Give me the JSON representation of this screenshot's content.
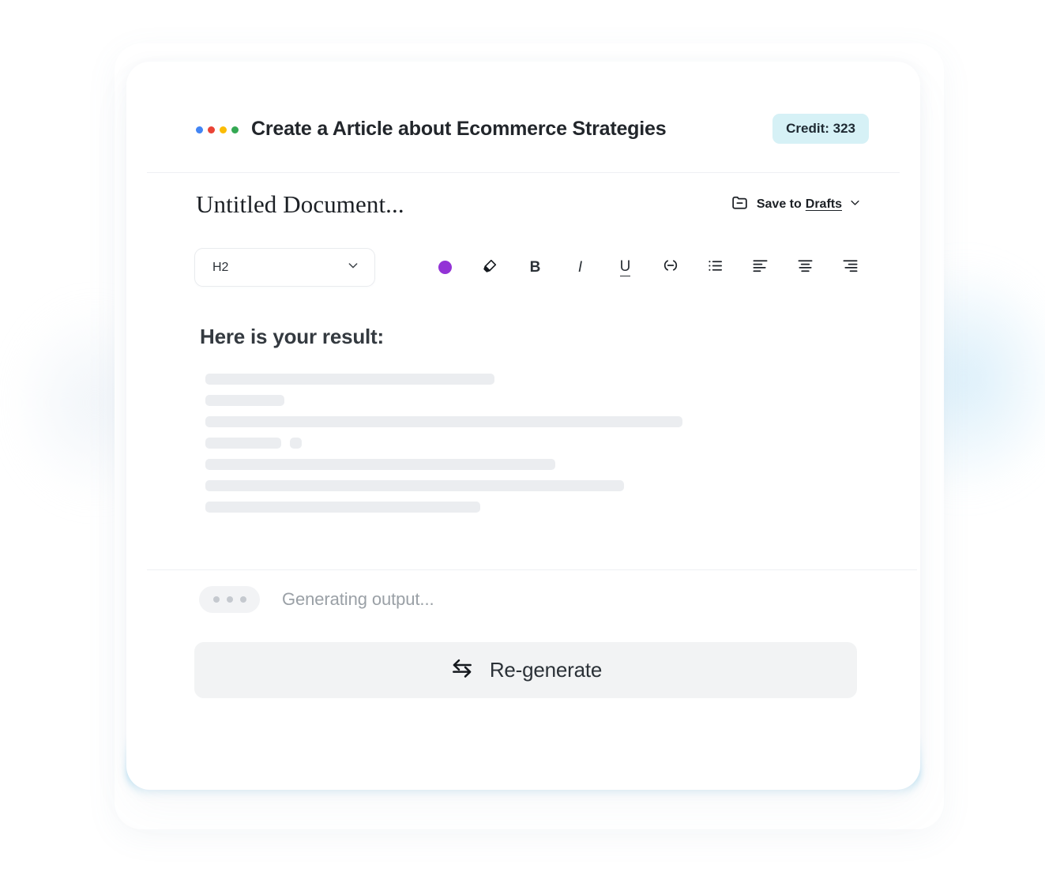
{
  "header": {
    "logo_icon": "four-dots-logo",
    "logo_dots": [
      "#4285f4",
      "#ea4335",
      "#fbbc05",
      "#34a853"
    ],
    "title": "Create a Article about Ecommerce Strategies",
    "credit_badge": "Credit: 323",
    "credit_badge_bg": "#d6f1f6"
  },
  "document": {
    "title": "Untitled Document...",
    "save_prefix": "Save to",
    "save_target": "Drafts",
    "save_icon": "folder-minus-icon",
    "save_chevron_icon": "chevron-down-icon"
  },
  "toolbar": {
    "style_value": "H2",
    "style_chevron_icon": "chevron-down-icon",
    "accent_color": "#9333d6",
    "tools": [
      {
        "name": "text-color-swatch",
        "icon": "color-swatch-icon",
        "label": ""
      },
      {
        "name": "highlighter",
        "icon": "highlighter-pen-icon",
        "label": ""
      },
      {
        "name": "bold",
        "icon": "bold-icon",
        "label": "B"
      },
      {
        "name": "italic",
        "icon": "italic-icon",
        "label": "I"
      },
      {
        "name": "underline",
        "icon": "underline-icon",
        "label": "U"
      },
      {
        "name": "link",
        "icon": "link-icon",
        "label": ""
      },
      {
        "name": "bulleted-list",
        "icon": "bulleted-list-icon",
        "label": ""
      },
      {
        "name": "align-left",
        "icon": "align-left-icon",
        "label": ""
      },
      {
        "name": "align-center",
        "icon": "align-center-icon",
        "label": ""
      },
      {
        "name": "align-right",
        "icon": "align-right-icon",
        "label": ""
      }
    ]
  },
  "result": {
    "heading": "Here is your result:",
    "skeleton_rows": [
      [
        366
      ],
      [
        100
      ],
      [
        604
      ],
      [
        96,
        15
      ],
      [
        443
      ],
      [
        530
      ],
      [
        348
      ]
    ],
    "skeleton_color": "#ebedf0"
  },
  "status": {
    "typing_icon": "three-dots-typing-icon",
    "text": "Generating output..."
  },
  "actions": {
    "regenerate_label": "Re-generate",
    "regenerate_icon": "swap-arrows-icon"
  }
}
